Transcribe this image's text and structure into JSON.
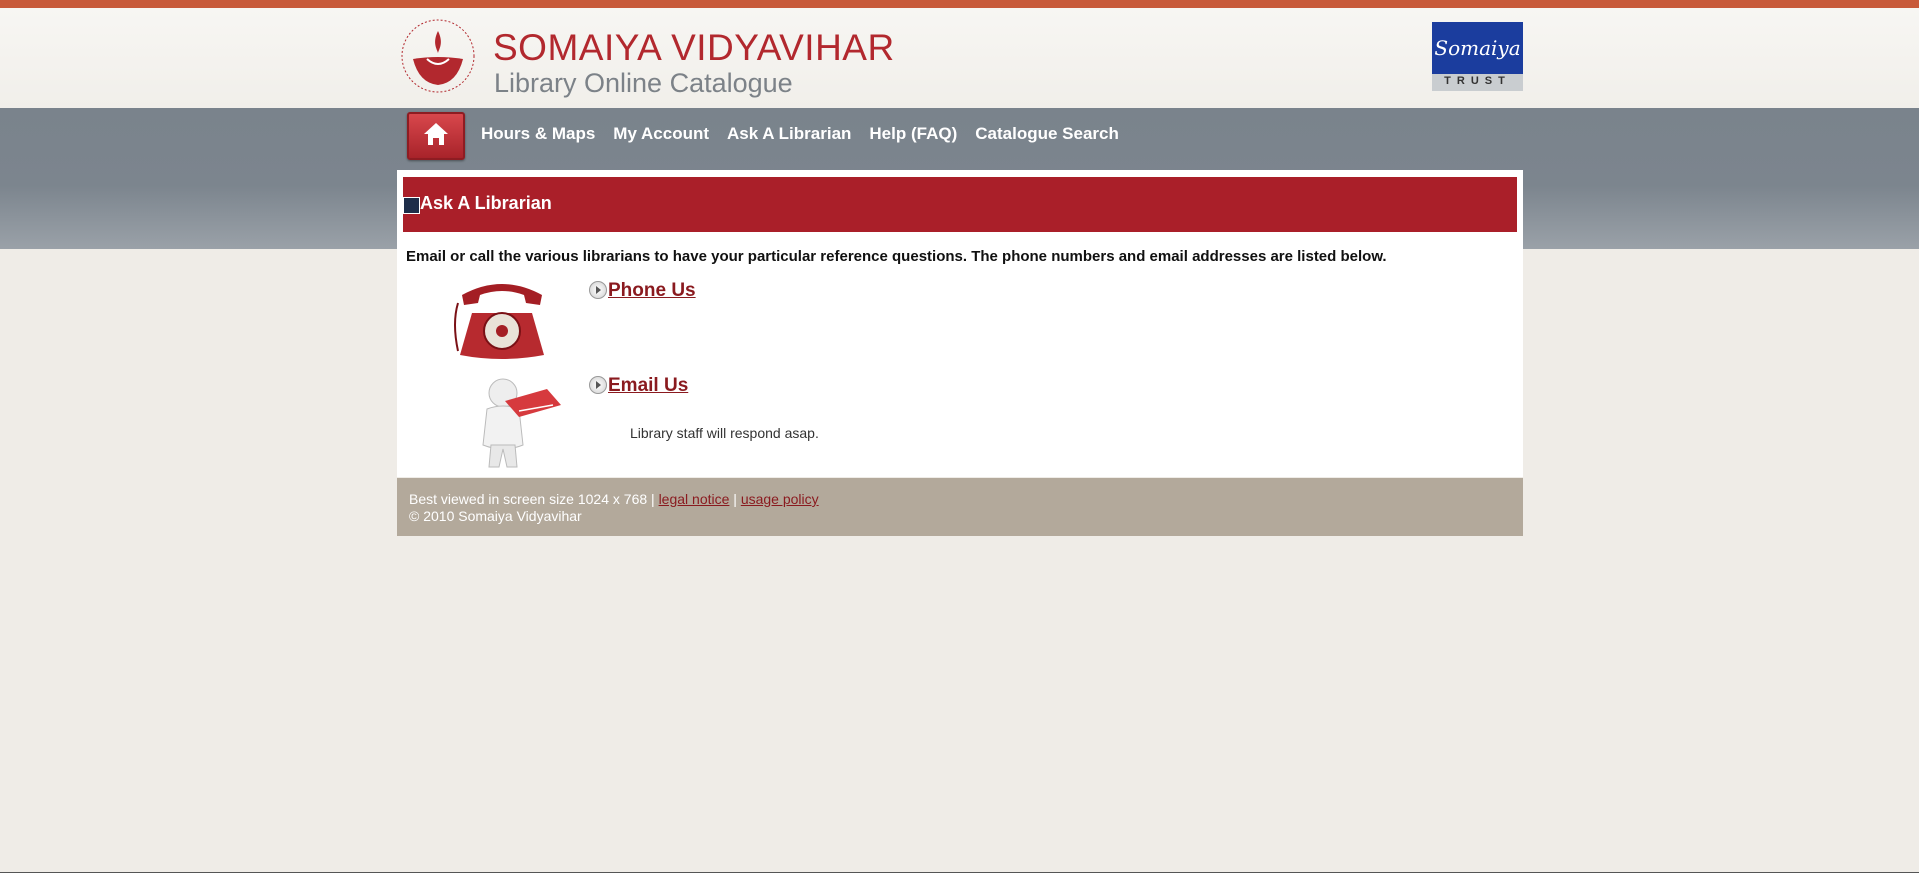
{
  "header": {
    "title": "SOMAIYA VIDYAVIHAR",
    "subtitle": "Library Online Catalogue",
    "trust_logo": {
      "name": "Somaiya",
      "label": "TRUST"
    }
  },
  "nav": {
    "home_icon": "home-icon",
    "items": [
      "Hours & Maps",
      "My Account",
      "Ask A Librarian",
      "Help (FAQ)",
      "Catalogue Search"
    ]
  },
  "page": {
    "title": "Ask A Librarian",
    "intro": "Email or call the various librarians to have your particular reference questions. The phone numbers and email addresses are listed below.",
    "phone_link": "Phone Us",
    "email_link": "Email Us",
    "email_note": "Library staff will respond asap."
  },
  "footer": {
    "best_viewed": "Best viewed in screen size 1024 x 768 |",
    "legal": "legal notice",
    "sep": "|",
    "usage": "usage policy",
    "copyright": "© 2010 Somaiya Vidyavihar"
  },
  "colors": {
    "accent": "#aa1f29",
    "nav_bg": "#7a838c",
    "footer_bg": "#b3a99b"
  }
}
